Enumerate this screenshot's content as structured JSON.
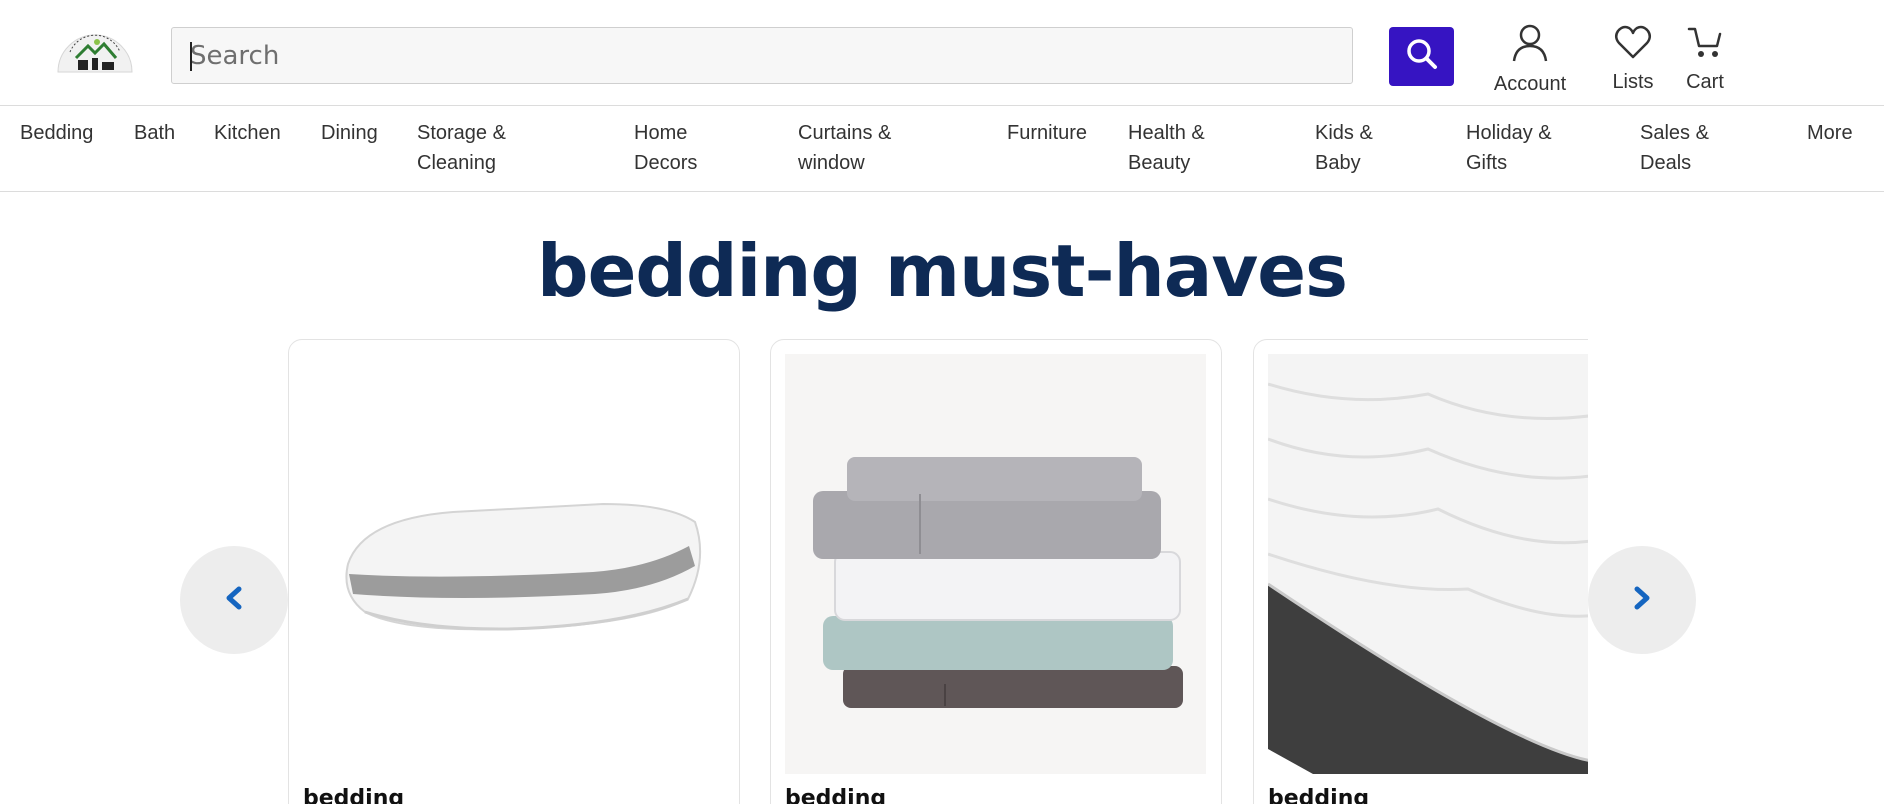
{
  "header": {
    "search": {
      "placeholder": "Search",
      "value": ""
    },
    "account_label": "Account",
    "lists_label": "Lists",
    "cart_label": "Cart"
  },
  "nav": {
    "items": [
      {
        "label": "Bedding"
      },
      {
        "label": "Bath"
      },
      {
        "label": "Kitchen"
      },
      {
        "label": "Dining"
      },
      {
        "label": "Storage &\nCleaning"
      },
      {
        "label": "Home\nDecors"
      },
      {
        "label": "Curtains &\nwindow"
      },
      {
        "label": "Furniture"
      },
      {
        "label": "Health &\nBeauty"
      },
      {
        "label": "Kids &\nBaby"
      },
      {
        "label": "Holiday &\nGifts"
      },
      {
        "label": "Sales &\nDeals"
      },
      {
        "label": "More"
      }
    ]
  },
  "main": {
    "heading": "bedding must-haves",
    "cards": [
      {
        "title": "bedding",
        "image": "pillow"
      },
      {
        "title": "bedding",
        "image": "folded-sheets"
      },
      {
        "title": "bedding",
        "image": "mattress-pad"
      }
    ]
  },
  "colors": {
    "brand": "#3614c2",
    "heading": "#0e2a55",
    "arrow_glyph": "#1565c0"
  },
  "icons": {
    "search": "search-icon",
    "account": "user-icon",
    "lists": "heart-icon",
    "cart": "cart-icon",
    "prev": "chevron-left-icon",
    "next": "chevron-right-icon"
  }
}
